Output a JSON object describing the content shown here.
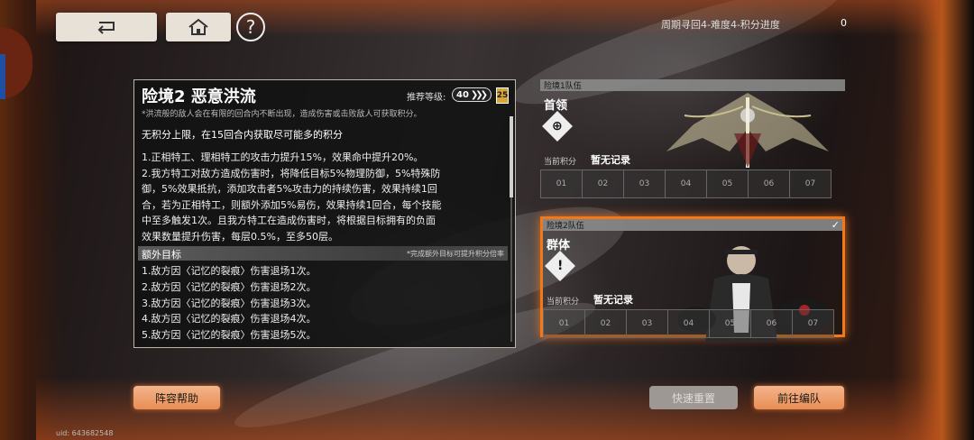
{
  "header": {
    "progress_label": "周期寻回4-难度4-积分进度",
    "progress_value": "0"
  },
  "stage": {
    "title": "险境2 恶意洪流",
    "recommended_label": "推荐等级:",
    "recommended_level": "40",
    "recommended_tier": "25",
    "note": "*洪流般的敌人会在有限的回合内不断出现，造成伤害或击败敌人可获取积分。",
    "subtitle": "无积分上限，在15回合内获取尽可能多的积分",
    "desc_lines": [
      "1.正相特工、理相特工的攻击力提升15%，效果命中提升20%。",
      "2.我方特工对敌方造成伤害时，将降低目标5%物理防御，5%特殊防",
      "御，5%效果抵抗，添加攻击者5%攻击力的持续伤害，效果持续1回",
      "合，若为正相特工，则额外添加5%易伤，效果持续1回合，每个技能",
      "中至多触发1次。且我方特工在造成伤害时，将根据目标拥有的负面",
      "效果数量提升伤害，每层0.5%，至多50层。"
    ],
    "extra_title": "额外目标",
    "extra_note": "*完成额外目标可提升积分倍率",
    "goals": [
      "1.敌方因〈记忆的裂痕〉伤害退场1次。",
      "2.敌方因〈记忆的裂痕〉伤害退场2次。",
      "3.敌方因〈记忆的裂痕〉伤害退场3次。",
      "4.敌方因〈记忆的裂痕〉伤害退场4次。",
      "5.敌方因〈记忆的裂痕〉伤害退场5次。"
    ]
  },
  "teams": [
    {
      "head": "险境1队伍",
      "type": "首领",
      "score_label": "当前积分",
      "score_value": "暂无记录",
      "slots": [
        "01",
        "02",
        "03",
        "04",
        "05",
        "06",
        "07"
      ]
    },
    {
      "head": "险境2队伍",
      "type": "群体",
      "score_label": "当前积分",
      "score_value": "暂无记录",
      "slots": [
        "01",
        "02",
        "03",
        "04",
        "05",
        "06",
        "07"
      ]
    }
  ],
  "buttons": {
    "help": "阵容帮助",
    "reset": "快速重置",
    "go": "前往编队"
  },
  "uid": "uid: 643682548",
  "icons": {
    "back": "back-arrow-icon",
    "home": "home-icon",
    "help": "question-icon",
    "check": "checkmark-icon"
  },
  "colors": {
    "accent_orange": "#f07a1a",
    "button_orange": "#e98e54",
    "level_gold": "#d9a43a"
  }
}
